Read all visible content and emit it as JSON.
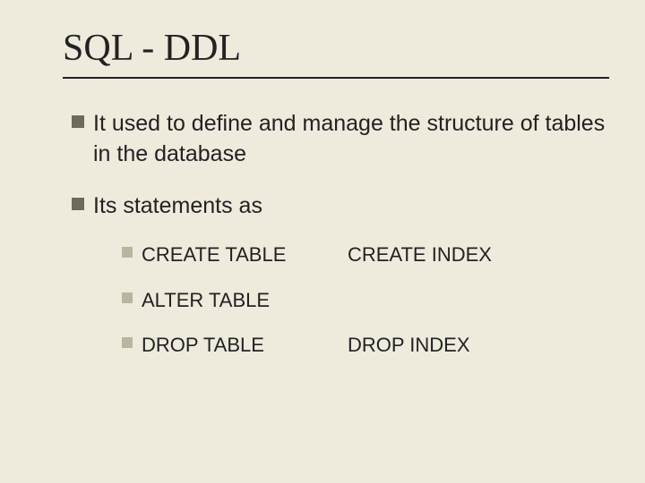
{
  "title": "SQL - DDL",
  "bullets": {
    "b1": "It used to define and manage the structure of tables in the database",
    "b2": "Its statements as",
    "sub": {
      "r1a": "CREATE TABLE",
      "r1b": "CREATE INDEX",
      "r2a": "ALTER TABLE",
      "r2b": "",
      "r3a": "DROP TABLE",
      "r3b": "DROP INDEX"
    }
  }
}
